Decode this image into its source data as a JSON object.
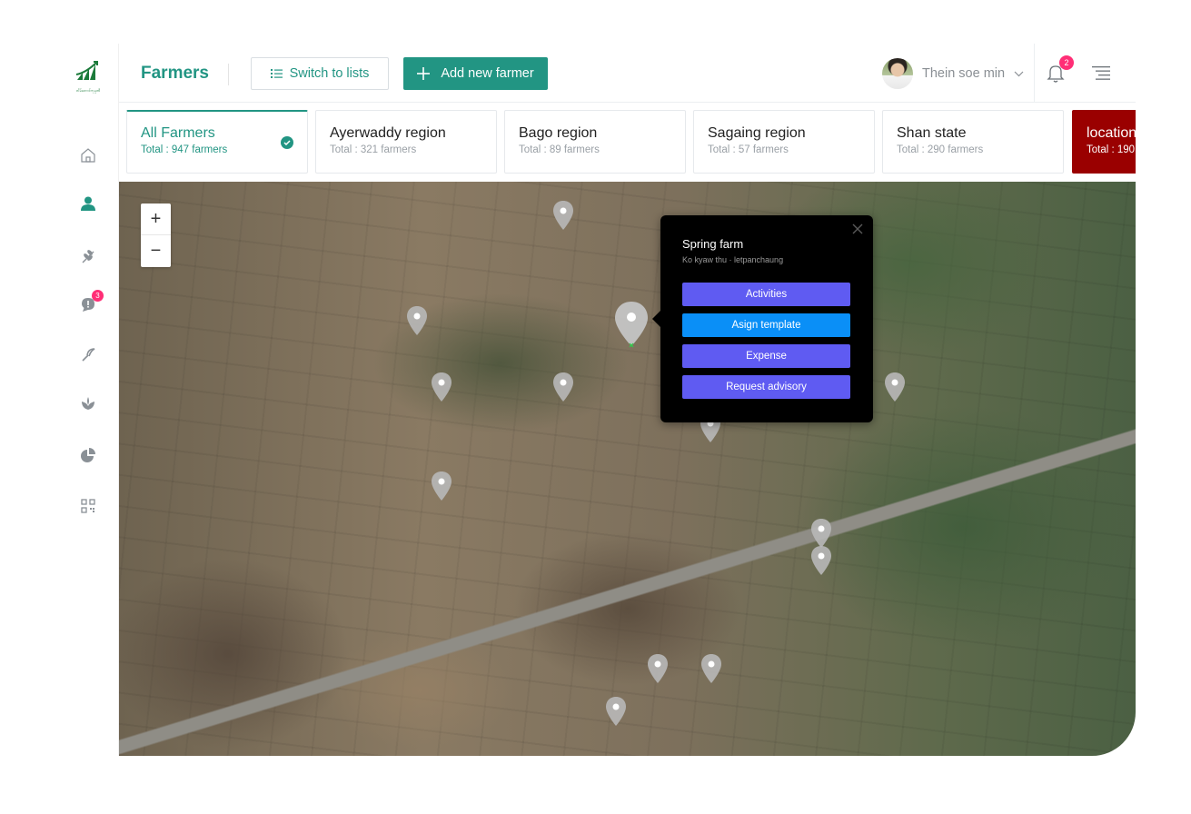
{
  "brand": {
    "logo_text": "တိမ်တောင်ကုမ္ပဏီ",
    "accent": "#229583"
  },
  "header": {
    "title": "Farmers",
    "switch_label": "Switch to lists",
    "add_label": "Add new farmer",
    "user_name": "Thein soe min",
    "notification_count": "2"
  },
  "sidebar": {
    "items": [
      {
        "icon": "home-icon"
      },
      {
        "icon": "user-icon",
        "active": true
      },
      {
        "icon": "plant-icon"
      },
      {
        "icon": "chat-icon",
        "badge": "3"
      },
      {
        "icon": "sickle-icon"
      },
      {
        "icon": "sprout-icon"
      },
      {
        "icon": "pie-chart-icon"
      },
      {
        "icon": "qr-code-icon"
      }
    ]
  },
  "regions": [
    {
      "name": "All Farmers",
      "total": "Total : 947 farmers",
      "active": true
    },
    {
      "name": "Ayerwaddy region",
      "total": "Total : 321 farmers"
    },
    {
      "name": "Bago region",
      "total": "Total : 89 farmers"
    },
    {
      "name": "Sagaing region",
      "total": "Total : 57 farmers"
    },
    {
      "name": "Shan state",
      "total": "Total : 290 farmers"
    },
    {
      "name": "location",
      "total": "Total : 190",
      "color": "#9a0000"
    }
  ],
  "map": {
    "zoom_in": "+",
    "zoom_out": "−",
    "popup": {
      "title": "Spring farm",
      "subtitle": "Ko kyaw thu · letpanchaung",
      "buttons": [
        {
          "label": "Activities",
          "color": "#5f5bf2"
        },
        {
          "label": "Asign template",
          "color": "#0a8ff7"
        },
        {
          "label": "Expense",
          "color": "#5f5bf2"
        },
        {
          "label": "Request advisory",
          "color": "#5f5bf2"
        }
      ]
    }
  }
}
